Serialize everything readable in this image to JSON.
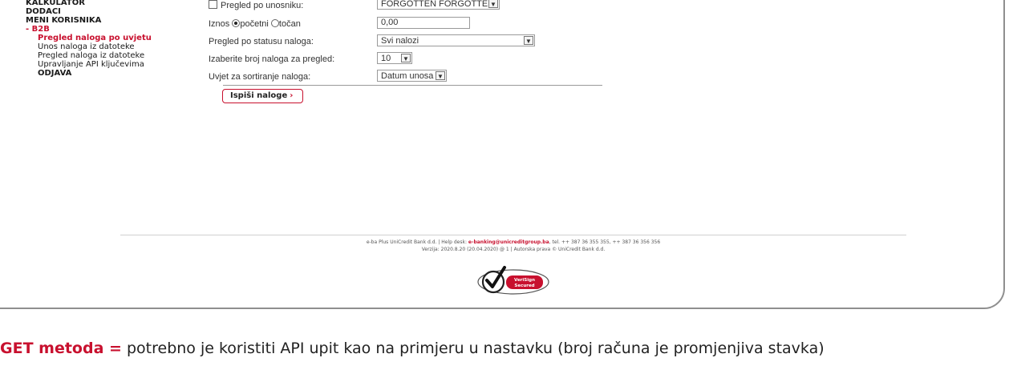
{
  "sidebar": {
    "items": [
      {
        "label": "KALKULATOR"
      },
      {
        "label": "DODACI"
      },
      {
        "label": "MENI KORISNIKA"
      }
    ],
    "group": {
      "label": "- B2B"
    },
    "subitems": [
      {
        "label": "Pregled naloga po uvjetu"
      },
      {
        "label": "Unos naloga iz datoteke"
      },
      {
        "label": "Pregled naloga iz datoteke"
      },
      {
        "label": "Upravljanje API ključevima"
      },
      {
        "label": "ODJAVA"
      }
    ]
  },
  "form": {
    "by_user": {
      "label": "Pregled po unosniku:",
      "checked": false,
      "value": "FORGOTTEN FORGOTTEN"
    },
    "amount": {
      "label_prefix": "Iznos",
      "opt_start": "početni",
      "opt_exact": "točan",
      "selected": "početni",
      "value": "0,00"
    },
    "status": {
      "label": "Pregled po statusu naloga:",
      "value": "Svi nalozi"
    },
    "count": {
      "label": "Izaberite broj naloga za pregled:",
      "value": "10"
    },
    "sort": {
      "label": "Uvjet za sortiranje naloga:",
      "value": "Datum unosa"
    },
    "submit_label": "Ispiši naloge"
  },
  "footer": {
    "line1_prefix": "e-ba Plus UniCredit Bank d.d.  |  Help desk:",
    "email": "e-banking@unicreditgroup.ba",
    "line1_suffix": ", tel. ++ 387 36 355 355, ++ 387 36 356 356",
    "line2": "Verzija: 2020.8.20 (20.04.2020) @ 1  |  Autorska prava © UniCredit Bank d.d.",
    "seal_line1": "VeriSign",
    "seal_line2": "Secured"
  },
  "body_text": {
    "key": "GET metoda =",
    "rest": " potrebno je koristiti API upit kao na primjeru u nastavku (broj računa je promjenjiva stavka)"
  }
}
